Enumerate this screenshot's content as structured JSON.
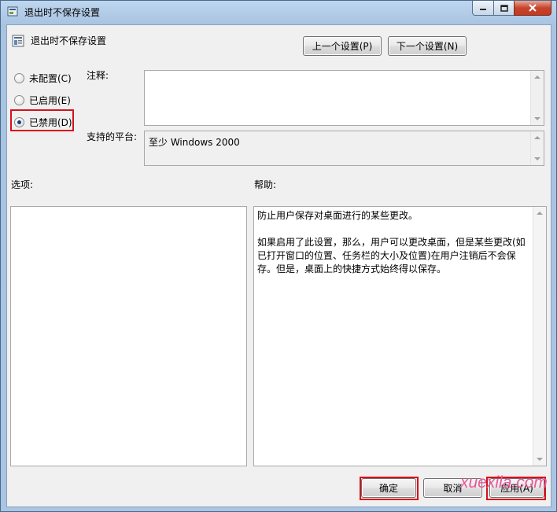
{
  "window": {
    "title": "退出时不保存设置",
    "colors": {
      "accent_red": "#d8101a",
      "titlebar": "#bfd6ee",
      "close_button": "#c7442c"
    }
  },
  "header": {
    "setting_name": "退出时不保存设置",
    "prev_button": "上一个设置(P)",
    "next_button": "下一个设置(N)"
  },
  "state": {
    "options": [
      {
        "label": "未配置(C)",
        "selected": false
      },
      {
        "label": "已启用(E)",
        "selected": false
      },
      {
        "label": "已禁用(D)",
        "selected": true
      }
    ]
  },
  "comment": {
    "label": "注释:",
    "value": ""
  },
  "platform": {
    "label": "支持的平台:",
    "value": "至少 Windows 2000"
  },
  "options_panel": {
    "label": "选项:"
  },
  "help_panel": {
    "label": "帮助:",
    "paragraphs": [
      "防止用户保存对桌面进行的某些更改。",
      "如果启用了此设置，那么，用户可以更改桌面，但是某些更改(如已打开窗口的位置、任务栏的大小及位置)在用户注销后不会保存。但是，桌面上的快捷方式始终得以保存。"
    ]
  },
  "footer": {
    "ok_button": "确定",
    "cancel_button": "取消",
    "apply_button": "应用(A)"
  },
  "watermark": "xuexila.com"
}
